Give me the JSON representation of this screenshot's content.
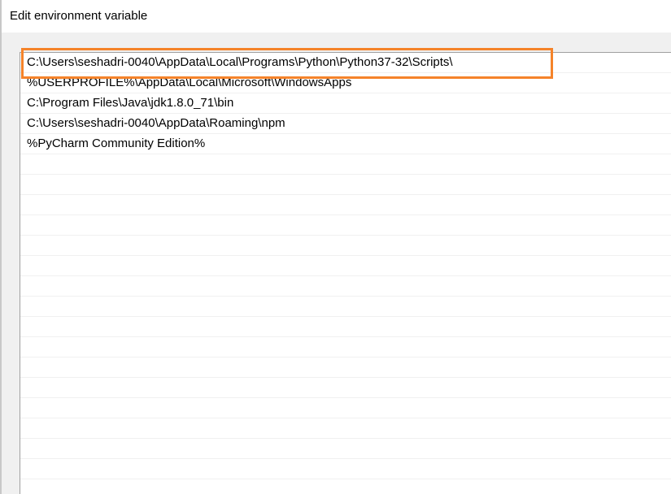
{
  "window": {
    "title": "Edit environment variable"
  },
  "entries": [
    "C:\\Users\\seshadri-0040\\AppData\\Local\\Programs\\Python\\Python37-32\\Scripts\\",
    "%USERPROFILE%\\AppData\\Local\\Microsoft\\WindowsApps",
    "C:\\Program Files\\Java\\jdk1.8.0_71\\bin",
    "C:\\Users\\seshadri-0040\\AppData\\Roaming\\npm",
    "%PyCharm Community Edition%"
  ],
  "empty_row_count": 16,
  "colors": {
    "highlight_border": "#f5832a",
    "list_background": "#ffffff",
    "window_background": "#f0f0f0"
  }
}
